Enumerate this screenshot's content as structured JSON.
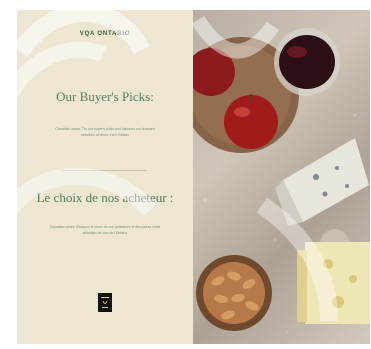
{
  "brand": {
    "name": "VQA ONTARIO"
  },
  "english": {
    "title": "Our Buyer's Picks:",
    "description": "Canadian wines. Try our buyer's picks and discover our featured selection of wines from Ontario"
  },
  "french": {
    "title": "Le choix de nos acheteur :",
    "description": "Canadian wines. Essayez le choix de nos acheteurs et découvrez notre sélection de vins de l'Ontario"
  },
  "logo": {
    "icon": "vqa-logo-icon"
  },
  "photo": {
    "description_icon": "wine-cheese-photo"
  },
  "colors": {
    "panel": "#ece6d3",
    "title": "#587c60",
    "brand": "#2f5b3a",
    "logo": "#11120f"
  }
}
